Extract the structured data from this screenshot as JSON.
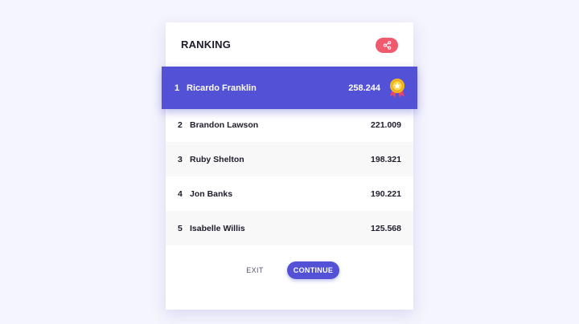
{
  "header": {
    "title": "RANKING",
    "share_icon": "share-icon",
    "share_color": "#ef5a6f"
  },
  "ranking": [
    {
      "rank": "1",
      "name": "Ricardo Franklin",
      "score": "258.244",
      "badge": "medal-icon"
    },
    {
      "rank": "2",
      "name": "Brandon Lawson",
      "score": "221.009"
    },
    {
      "rank": "3",
      "name": "Ruby Shelton",
      "score": "198.321"
    },
    {
      "rank": "4",
      "name": "Jon Banks",
      "score": "190.221"
    },
    {
      "rank": "5",
      "name": "Isabelle Willis",
      "score": "125.568"
    }
  ],
  "footer": {
    "exit_label": "EXIT",
    "continue_label": "CONTINUE"
  },
  "colors": {
    "accent": "#5352d6",
    "share": "#ef5a6f",
    "background": "#f5f5fd"
  }
}
